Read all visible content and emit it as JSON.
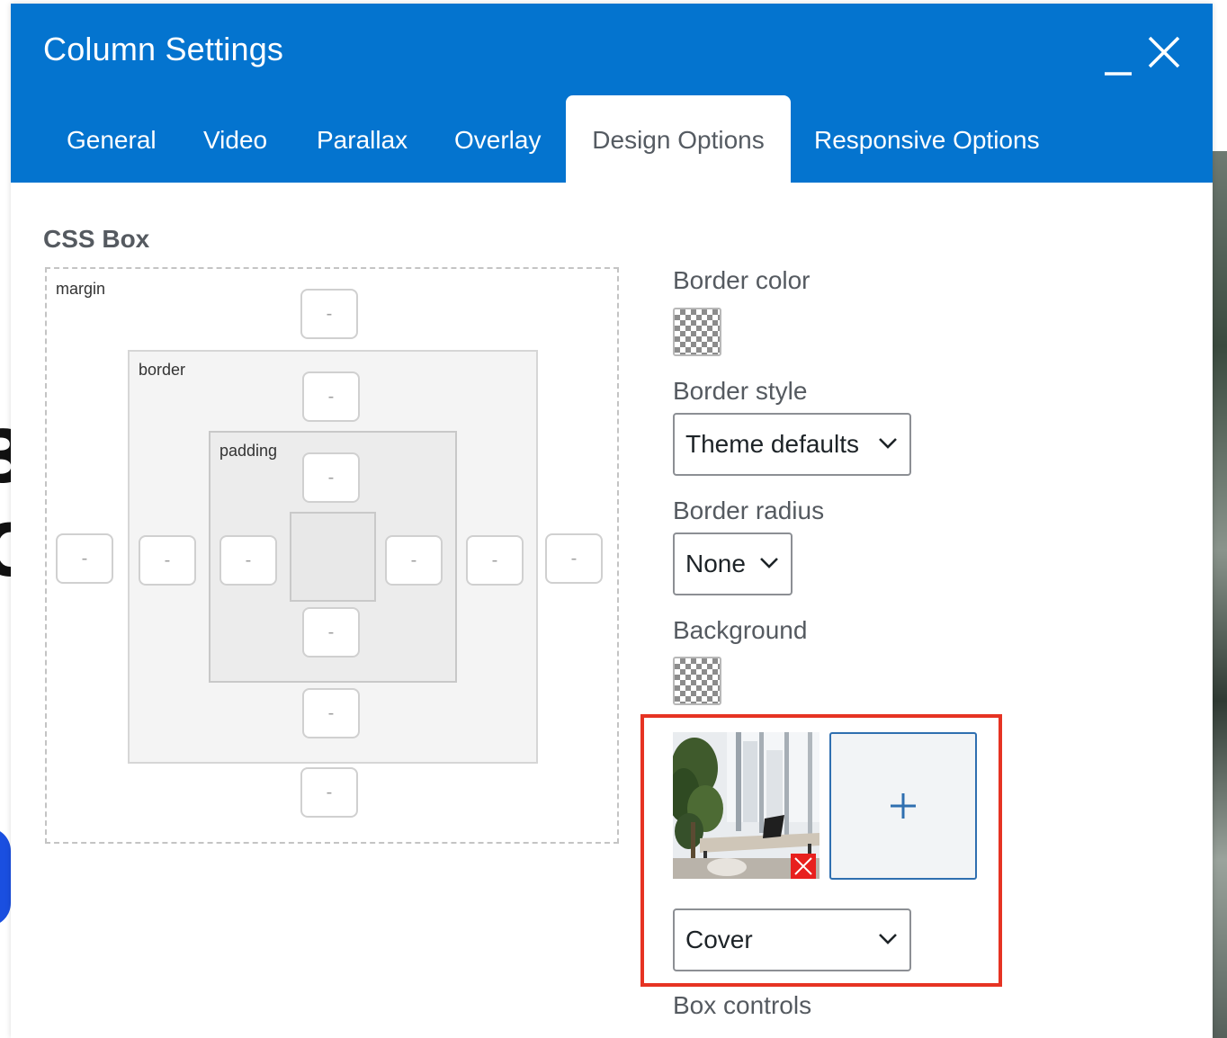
{
  "modal": {
    "title": "Column Settings",
    "tabs": [
      {
        "label": "General"
      },
      {
        "label": "Video"
      },
      {
        "label": "Parallax"
      },
      {
        "label": "Overlay"
      },
      {
        "label": "Design Options",
        "active": true
      },
      {
        "label": "Responsive Options"
      }
    ],
    "icons": {
      "minimize": "minimize-icon",
      "close": "close-icon"
    }
  },
  "css_box": {
    "title": "CSS Box",
    "margin_label": "margin",
    "border_label": "border",
    "padding_label": "padding",
    "placeholder": "-"
  },
  "design": {
    "border_color_label": "Border color",
    "border_style_label": "Border style",
    "border_style_value": "Theme defaults",
    "border_radius_label": "Border radius",
    "border_radius_value": "None",
    "background_label": "Background",
    "background_size_value": "Cover",
    "box_controls_label": "Box controls"
  },
  "colors": {
    "header": "#0474cf",
    "highlight": "#e63323",
    "remove": "#e8201e",
    "add_border": "#2f6fb0"
  }
}
